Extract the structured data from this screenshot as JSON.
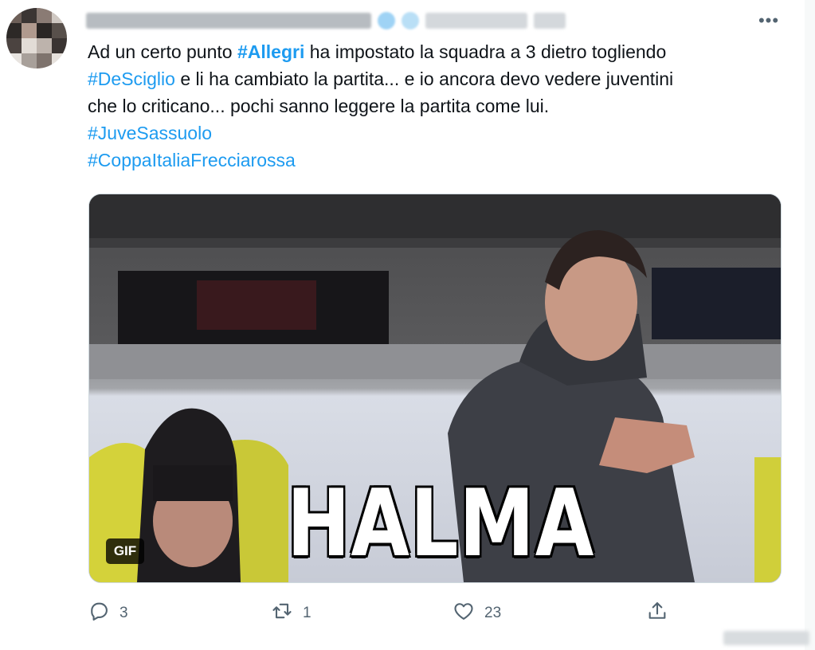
{
  "tweet": {
    "text_line1_a": "Ad un certo punto ",
    "hashtag_allegri": "#Allegri",
    "text_line1_b": " ha impostato la squadra a 3 dietro togliendo",
    "hashtag_desciglio": "#DeSciglio",
    "text_line2": " e li ha cambiato la partita... e io ancora devo vedere juventini",
    "text_line3": "che lo criticano... pochi sanno leggere la partita come lui.",
    "hashtag_juvesassuolo": "#JuveSassuolo",
    "hashtag_coppaitalia": "#CoppaItaliaFrecciarossa"
  },
  "more_icon": "more-options-icon",
  "more_label": "•••",
  "media": {
    "overlay_text": "HALMA",
    "badge": "GIF"
  },
  "actions": {
    "reply_count": "3",
    "retweet_count": "1",
    "like_count": "23"
  },
  "colors": {
    "link": "#1d9bf0",
    "muted": "#536471",
    "text": "#0f1419"
  }
}
